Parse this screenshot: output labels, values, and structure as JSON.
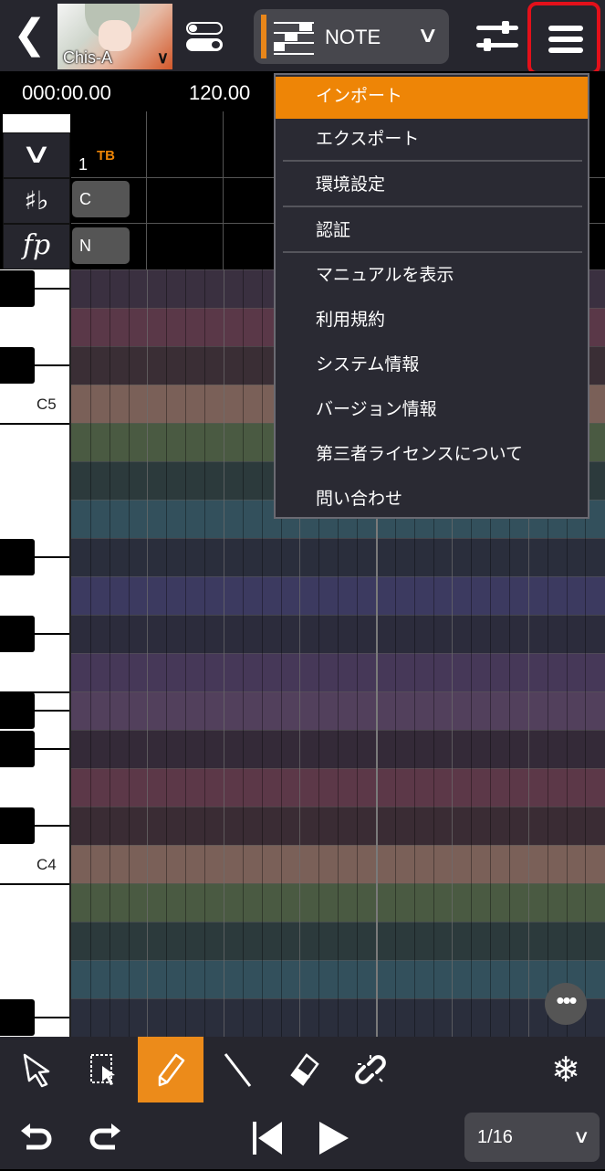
{
  "header": {
    "singer_name": "Chis-A",
    "mode": "NOTE"
  },
  "timeline": {
    "time": "000:00.00",
    "tempo": "120.00",
    "measure": "1",
    "marker": "TB"
  },
  "tracks": {
    "key": "C",
    "dynamics": "N"
  },
  "piano": {
    "labels": [
      "C5",
      "C4"
    ]
  },
  "menu": {
    "items": [
      "インポート",
      "エクスポート",
      "環境設定",
      "認証",
      "マニュアルを表示",
      "利用規約",
      "システム情報",
      "バージョン情報",
      "第三者ライセンスについて",
      "問い合わせ"
    ],
    "selected": "インポート"
  },
  "grid": {
    "row_colors": [
      "#3a3040",
      "#5a3848",
      "#3a2e35",
      "#7a6058",
      "#4a5a42",
      "#2c3a3c",
      "#33505c",
      "#2a2e3c",
      "#3c3a60",
      "#2c2c3c",
      "#463858",
      "#52405c",
      "#342a38",
      "#5c3848",
      "#3a2c34",
      "#7a6058",
      "#4a5a42",
      "#2c3a3c",
      "#33505c",
      "#2a2e3c"
    ]
  },
  "accent": "#ee8506",
  "bottom": {
    "quantize": "1/16",
    "more": "•••"
  }
}
